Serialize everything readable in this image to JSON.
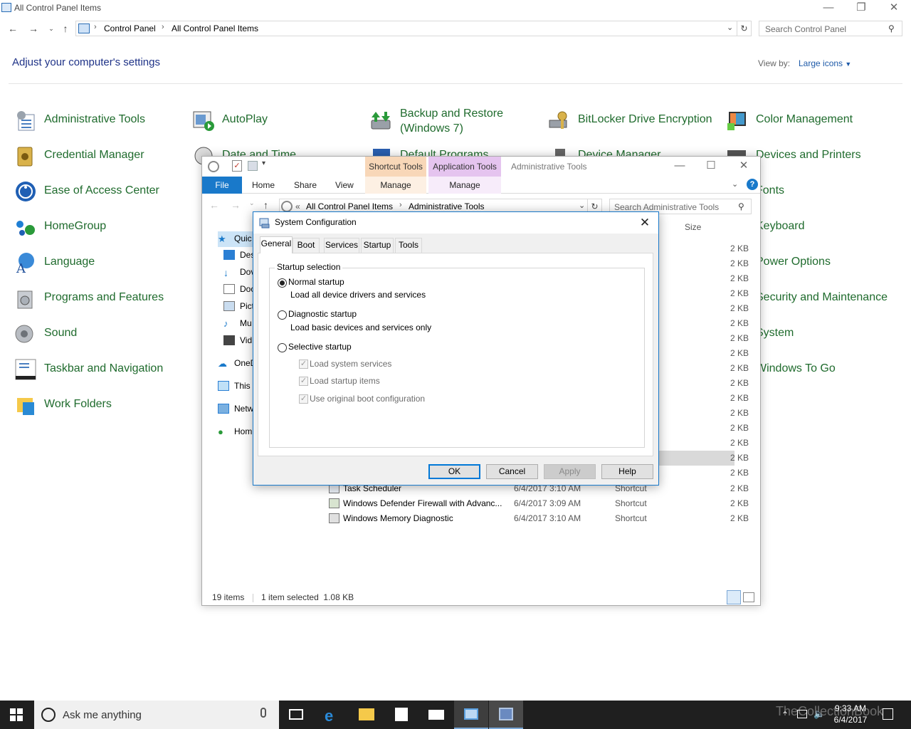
{
  "control_panel": {
    "window_title": "All Control Panel Items",
    "breadcrumb": [
      "Control Panel",
      "All Control Panel Items"
    ],
    "search_placeholder": "Search Control Panel",
    "heading": "Adjust your computer's settings",
    "view_by_label": "View by:",
    "view_by_value": "Large icons",
    "items": [
      "Administrative Tools",
      "AutoPlay",
      "Backup and Restore (Windows 7)",
      "BitLocker Drive Encryption",
      "Color Management",
      "Credential Manager",
      "Date and Time",
      "Default Programs",
      "Device Manager",
      "Devices and Printers",
      "Ease of Access Center",
      "Fonts",
      "HomeGroup",
      "Keyboard",
      "Language",
      "Power Options",
      "Programs and Features",
      "Security and Maintenance",
      "Sound",
      "System",
      "Taskbar and Navigation",
      "Windows To Go",
      "Work Folders"
    ]
  },
  "explorer": {
    "title": "Administrative Tools",
    "contextual_tabs": [
      "Shortcut Tools",
      "Application Tools"
    ],
    "ribbon_tabs": [
      "File",
      "Home",
      "Share",
      "View",
      "Manage",
      "Manage"
    ],
    "breadcrumb": [
      "All Control Panel Items",
      "Administrative Tools"
    ],
    "search_placeholder": "Search Administrative Tools",
    "nav_items": [
      "Quic",
      "Des",
      "Dov",
      "Doc",
      "Pict",
      "Mu",
      "Vid",
      "OneD",
      "This",
      "Netw",
      "Hom"
    ],
    "size_header": "Size",
    "size_value": "2 KB",
    "files": [
      {
        "name": "Task Scheduler",
        "date": "6/4/2017 3:10 AM",
        "type": "Shortcut",
        "size": "2 KB"
      },
      {
        "name": "Windows Defender Firewall with Advanc...",
        "date": "6/4/2017 3:09 AM",
        "type": "Shortcut",
        "size": "2 KB"
      },
      {
        "name": "Windows Memory Diagnostic",
        "date": "6/4/2017 3:10 AM",
        "type": "Shortcut",
        "size": "2 KB"
      }
    ],
    "status_count": "19 items",
    "status_selected": "1 item selected  1.08 KB"
  },
  "sysconfig": {
    "title": "System Configuration",
    "tabs": [
      "General",
      "Boot",
      "Services",
      "Startup",
      "Tools"
    ],
    "group_label": "Startup selection",
    "normal_label": "Normal startup",
    "normal_desc": "Load all device drivers and services",
    "diagnostic_label": "Diagnostic startup",
    "diagnostic_desc": "Load basic devices and services only",
    "selective_label": "Selective startup",
    "selective_options": [
      "Load system services",
      "Load startup items",
      "Use original boot configuration"
    ],
    "buttons": {
      "ok": "OK",
      "cancel": "Cancel",
      "apply": "Apply",
      "help": "Help"
    }
  },
  "taskbar": {
    "search_placeholder": "Ask me anything",
    "time": "9:33 AM",
    "date": "6/4/2017",
    "watermark": "TheCollectionBook"
  }
}
